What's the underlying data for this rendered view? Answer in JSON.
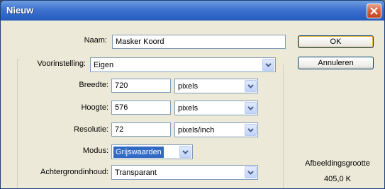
{
  "window": {
    "title": "Nieuw"
  },
  "naam": {
    "label": "Naam:",
    "value": "Masker Koord"
  },
  "voorinstelling": {
    "label": "Voorinstelling:",
    "value": "Eigen"
  },
  "breedte": {
    "label": "Breedte:",
    "value": "720",
    "unit": "pixels"
  },
  "hoogte": {
    "label": "Hoogte:",
    "value": "576",
    "unit": "pixels"
  },
  "resolutie": {
    "label": "Resolutie:",
    "value": "72",
    "unit": "pixels/inch"
  },
  "modus": {
    "label": "Modus:",
    "value": "Grijswaarden"
  },
  "achtergrond": {
    "label": "Achtergrondinhoud:",
    "value": "Transparant"
  },
  "buttons": {
    "ok": "OK",
    "cancel": "Annuleren"
  },
  "image_size": {
    "label": "Afbeeldingsgrootte",
    "value": "405,0 K"
  },
  "colors": {
    "titlebar": "#245bbd",
    "dialog_bg": "#ece9d8",
    "close": "#d75f3f",
    "selection": "#316ac5"
  },
  "icons": {
    "close": "close-icon",
    "dropdown": "chevron-down-icon"
  }
}
